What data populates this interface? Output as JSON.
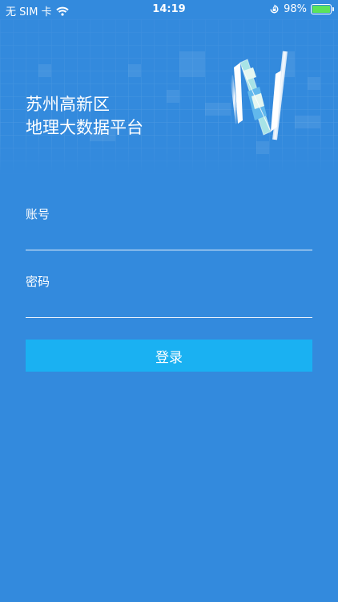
{
  "status_bar": {
    "carrier": "无 SIM 卡",
    "time": "14:19",
    "battery_percent": "98%",
    "battery_level": 0.98,
    "icons": [
      "wifi-icon",
      "orientation-lock-icon",
      "battery-icon"
    ]
  },
  "header": {
    "title_line1": "苏州高新区",
    "title_line2": "地理大数据平台",
    "logo_icon": "map-n-logo"
  },
  "form": {
    "account_label": "账号",
    "account_value": "",
    "password_label": "密码",
    "password_value": "",
    "login_label": "登录"
  },
  "colors": {
    "background": "#338ADD",
    "button": "#1AB1F2",
    "input_line": "#E8F1FB",
    "battery_fill": "#5BE35B"
  }
}
